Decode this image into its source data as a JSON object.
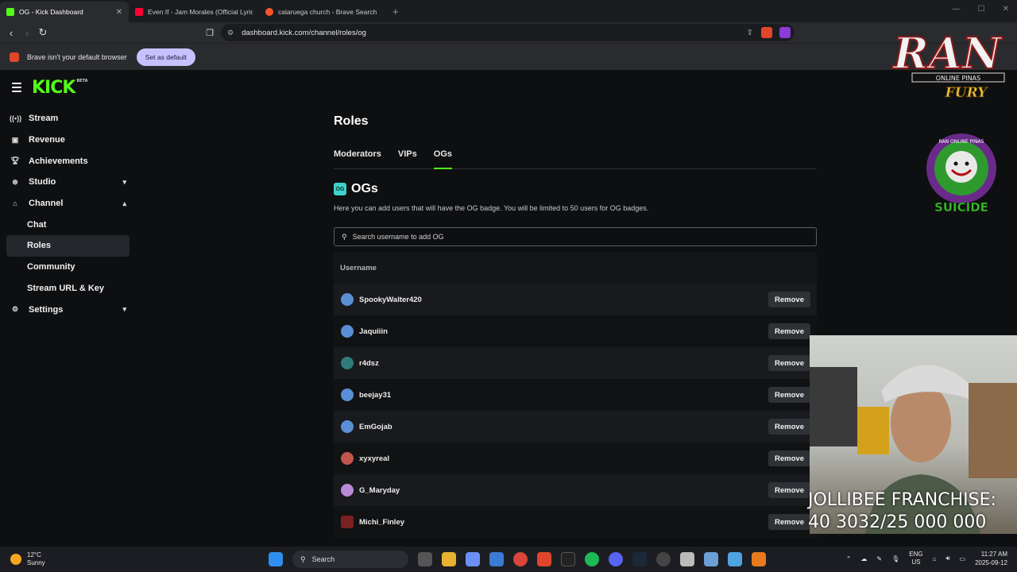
{
  "browser": {
    "tabs": [
      {
        "title": "OG - Kick Dashboard",
        "active": true,
        "favicon_color": "#53fc18"
      },
      {
        "title": "Even If - Jam Morales (Official Lyric V",
        "active": false,
        "favicon_color": "#ff0033"
      },
      {
        "title": "calaruega church - Brave Search",
        "active": false,
        "favicon_color": "#fb542b"
      }
    ],
    "new_tab": "+",
    "url": "dashboard.kick.com/channel/roles/og",
    "infobar": {
      "message": "Brave isn't your default browser",
      "button": "Set as default"
    }
  },
  "kick": {
    "logo": "KICK",
    "logo_badge": "BETA",
    "brand_color": "#53fc18",
    "sidebar": [
      {
        "label": "Stream",
        "icon": "broadcast-icon"
      },
      {
        "label": "Revenue",
        "icon": "wallet-icon"
      },
      {
        "label": "Achievements",
        "icon": "trophy-icon"
      },
      {
        "label": "Studio",
        "icon": "studio-icon",
        "chevron": "down"
      },
      {
        "label": "Channel",
        "icon": "home-icon",
        "chevron": "up"
      },
      {
        "label": "Chat",
        "sub": true
      },
      {
        "label": "Roles",
        "sub": true,
        "selected": true
      },
      {
        "label": "Community",
        "sub": true
      },
      {
        "label": "Stream URL & Key",
        "sub": true
      },
      {
        "label": "Settings",
        "icon": "gear-icon",
        "chevron": "down"
      }
    ],
    "page_title": "Roles",
    "tabs": [
      "Moderators",
      "VIPs",
      "OGs"
    ],
    "active_tab": "OGs",
    "section_title": "OGs",
    "section_badge": "OG",
    "description": "Here you can add users that will have the OG badge. You will be limited to 50 users for OG badges.",
    "search_placeholder": "Search username to add OG",
    "table_header": "Username",
    "remove_label": "Remove",
    "users": [
      {
        "name": "SpookyWalter420",
        "avatar_color": "#5a8fd6"
      },
      {
        "name": "Jaquiiin",
        "avatar_color": "#5a8fd6"
      },
      {
        "name": "r4dsz",
        "avatar_color": "#2f7a7a"
      },
      {
        "name": "beejay31",
        "avatar_color": "#5a8fd6"
      },
      {
        "name": "EmGojab",
        "avatar_color": "#5a8fd6"
      },
      {
        "name": "xyxyreal",
        "avatar_color": "#c0564b"
      },
      {
        "name": "G_Maryday",
        "avatar_color": "#b98ad6"
      },
      {
        "name": "Michi_Finley",
        "avatar_color": "#7a2020"
      }
    ]
  },
  "overlay": {
    "ran_logo_text": "RAN",
    "ran_sub": "ONLINE PINAS",
    "ran_fury": "FURY",
    "badge_top": "RAN ONLINE PINAS",
    "badge_bottom": "SUICIDE",
    "franchise_line1": "JOLLIBEE FRANCHISE:",
    "franchise_line2": "40 3032/25 000 000"
  },
  "taskbar": {
    "temperature": "12°C",
    "condition": "Sunny",
    "search": "Search",
    "lang_top": "ENG",
    "lang_bottom": "US",
    "time": "11:27 AM",
    "date": "2025-09-12"
  }
}
